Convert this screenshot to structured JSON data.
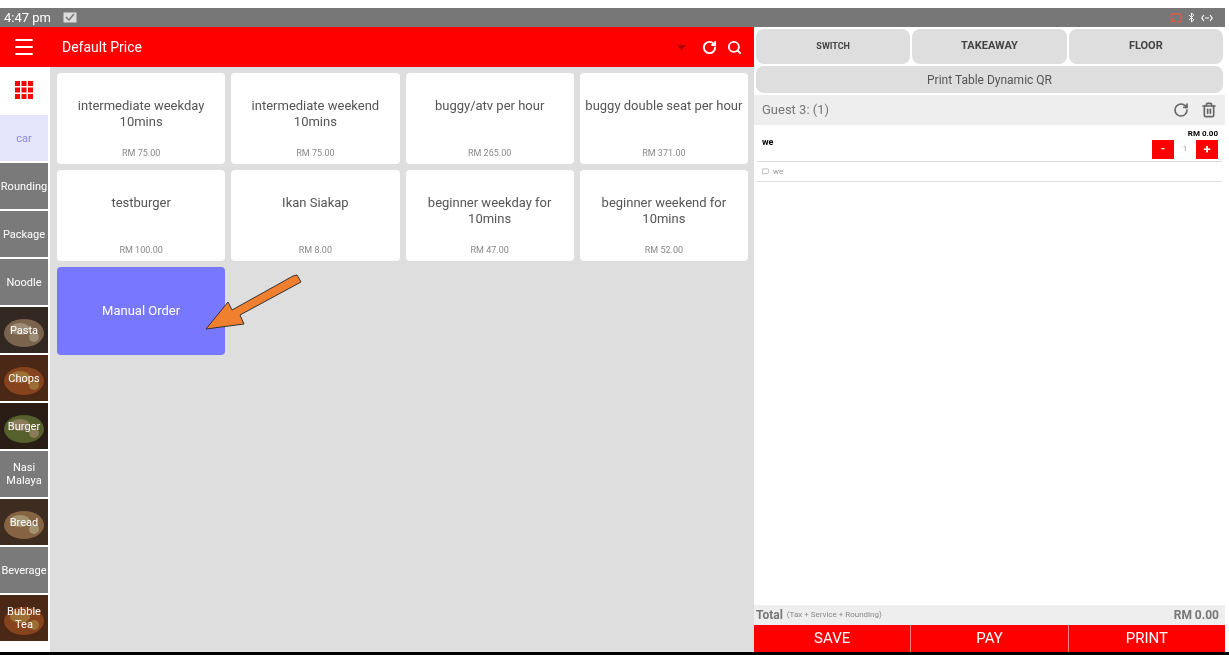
{
  "status_bar": {
    "time": "4:47 pm"
  },
  "header": {
    "title": "Default Price"
  },
  "categories": [
    {
      "label": "car",
      "kind": "plain",
      "selected": true
    },
    {
      "label": "Rounding",
      "kind": "plain",
      "selected": false
    },
    {
      "label": "Package",
      "kind": "plain",
      "selected": false
    },
    {
      "label": "Noodle",
      "kind": "plain",
      "selected": false
    },
    {
      "label": "Pasta",
      "kind": "picture",
      "selected": false
    },
    {
      "label": "Chops",
      "kind": "picture",
      "selected": false
    },
    {
      "label": "Burger",
      "kind": "picture",
      "selected": false
    },
    {
      "label": "Nasi Malaya",
      "kind": "plain",
      "selected": false
    },
    {
      "label": "Bread",
      "kind": "picture",
      "selected": false
    },
    {
      "label": "Beverage",
      "kind": "plain",
      "selected": false
    },
    {
      "label": "Bubble Tea",
      "kind": "picture",
      "selected": false
    }
  ],
  "products": [
    {
      "name": "intermediate weekday 10mins",
      "price": "RM 75.00",
      "kind": "item"
    },
    {
      "name": "intermediate weekend 10mins",
      "price": "RM 75.00",
      "kind": "item"
    },
    {
      "name": "buggy/atv per hour",
      "price": "RM 265.00",
      "kind": "item"
    },
    {
      "name": "buggy double seat per hour",
      "price": "RM 371.00",
      "kind": "item"
    },
    {
      "name": "testburger",
      "price": "RM 100.00",
      "kind": "item"
    },
    {
      "name": "Ikan Siakap",
      "price": "RM 8.00",
      "kind": "item"
    },
    {
      "name": "beginner weekday for 10mins",
      "price": "RM 47.00",
      "kind": "item"
    },
    {
      "name": "beginner weekend for 10mins",
      "price": "RM 52.00",
      "kind": "item"
    },
    {
      "name": "Manual Order",
      "kind": "manual"
    }
  ],
  "order_panel": {
    "top_buttons": [
      "SWITCH",
      "TAKEAWAY",
      "FLOOR"
    ],
    "qr_button": "Print Table Dynamic QR",
    "guest": "Guest 3: (1)",
    "items": [
      {
        "name": "we",
        "price": "RM 0.00",
        "quantity": "1",
        "decrease": "-",
        "increase": "+",
        "note": "we"
      }
    ],
    "total_label": "Total",
    "total_note": "(Tax + Service + Rounding)",
    "total": "RM 0.00",
    "actions": [
      "SAVE",
      "PAY",
      "PRINT"
    ]
  }
}
